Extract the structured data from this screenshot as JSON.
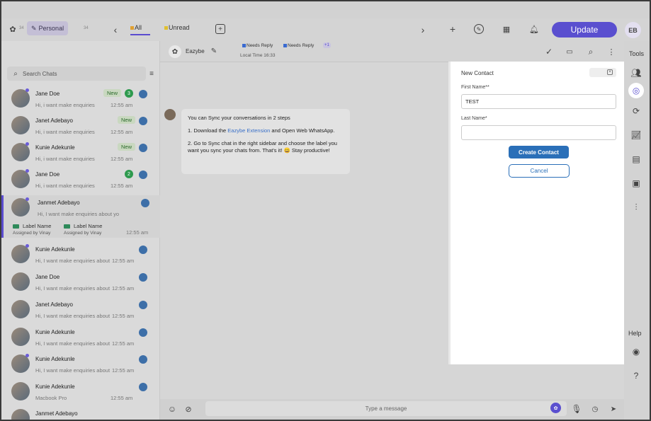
{
  "topbar": {
    "personal_label": "Personal",
    "personal_count": "34",
    "personal_count2": "34",
    "tab_all": "All",
    "tab_unread": "Unread",
    "update_label": "Update",
    "user_initials": "EB"
  },
  "sidebar": {
    "search_placeholder": "Search Chats",
    "chats": [
      {
        "name": "Jane Doe",
        "message": "Hi, i want make enquiries",
        "time": "12:55 am",
        "badge": "New",
        "count": "3"
      },
      {
        "name": "Janet Adebayo",
        "message": "Hi, i want make enquiries",
        "time": "12:55 am",
        "badge": "New"
      },
      {
        "name": "Kunie Adekunle",
        "message": "Hi, i want make enquiries",
        "time": "12:55 am",
        "badge": "New"
      },
      {
        "name": "Jane Doe",
        "message": "Hi, i want make enquiries",
        "time": "12:55 am",
        "count": "2"
      },
      {
        "name": "Janmet Adebayo",
        "message": "Hi, I want make enquiries about yo",
        "time": "12:55 am",
        "label1": "Label Name",
        "label2": "Label Name",
        "assigned1": "Assigned by Vinay",
        "assigned2": "Assigned by Vinay"
      },
      {
        "name": "Kunie Adekunle",
        "message": "Hi, I want make enquiries about",
        "time": "12:55 am"
      },
      {
        "name": "Jane Doe",
        "message": "Hi, I want make enquiries about",
        "time": "12:55 am"
      },
      {
        "name": "Janet Adebayo",
        "message": "Hi, I want make enquiries about",
        "time": "12:55 am"
      },
      {
        "name": "Kunie Adekunle",
        "message": "Hi, I want make enquiries about",
        "time": "12:55 am"
      },
      {
        "name": "Kunie Adekunle",
        "message": "Hi, I want make enquiries about",
        "time": "12:55 am"
      },
      {
        "name": "Kunie Adekunle",
        "message": "Macbook Pro",
        "time": "12:55 am"
      },
      {
        "name": "Janmet Adebayo",
        "message": "",
        "time": ""
      }
    ]
  },
  "chat": {
    "contact_name": "Eazybe",
    "local_time": "Local Time 16:33",
    "pill1": "Needs Reply",
    "pill2": "Needs Reply",
    "pill_more": "+1",
    "bubble_line1": "You can Sync your conversations in 2 steps",
    "bubble_step1_a": "1. Download the ",
    "bubble_step1_link": "Eazybe Extension",
    "bubble_step1_b": " and Open Web WhatsApp.",
    "bubble_step2": "2. Go to Sync chat in the right sidebar and choose the label you want you sync your chats from. That's it! 😀 Stay productive!",
    "input_placeholder": "Type a message"
  },
  "modal": {
    "title": "New Contact",
    "first_name_label": "First Name**",
    "first_name_value": "TEST",
    "last_name_label": "Last Name*",
    "last_name_value": "",
    "create_label": "Create Contact",
    "cancel_label": "Cancel"
  },
  "tools": {
    "header": "Tools",
    "help": "Help"
  }
}
